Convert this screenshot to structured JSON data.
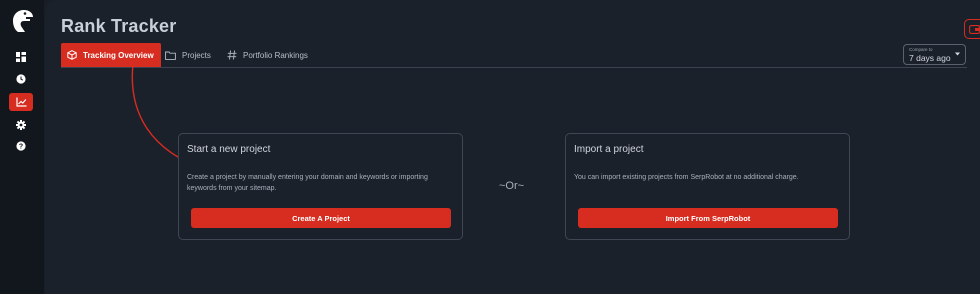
{
  "app": {
    "title": "Rank Tracker"
  },
  "sidebar": {
    "logo": "dinosaur-logo",
    "items": [
      {
        "icon": "dashboard-icon",
        "active": false
      },
      {
        "icon": "history-icon",
        "active": false
      },
      {
        "icon": "chart-icon",
        "active": true
      },
      {
        "icon": "settings-icon",
        "active": false
      },
      {
        "icon": "help-icon",
        "active": false
      }
    ]
  },
  "tabs": [
    {
      "label": "Tracking Overview",
      "icon": "box-icon",
      "active": true
    },
    {
      "label": "Projects",
      "icon": "folder-icon",
      "active": false
    },
    {
      "label": "Portfolio Rankings",
      "icon": "hash-icon",
      "active": false
    }
  ],
  "compare": {
    "label": "Compare to",
    "value": "7 days ago"
  },
  "new_project_card": {
    "title": "Start a new project",
    "description": "Create a project by manually entering your domain and keywords or importing keywords from your sitemap.",
    "button": "Create A Project"
  },
  "separator": "~Or~",
  "import_card": {
    "title": "Import a project",
    "description": "You can import existing projects from SerpRobot at no additional charge.",
    "button": "Import From SerpRobot"
  },
  "colors": {
    "accent": "#d72c20",
    "background": "#1b212b",
    "sidebar": "#12161d"
  }
}
